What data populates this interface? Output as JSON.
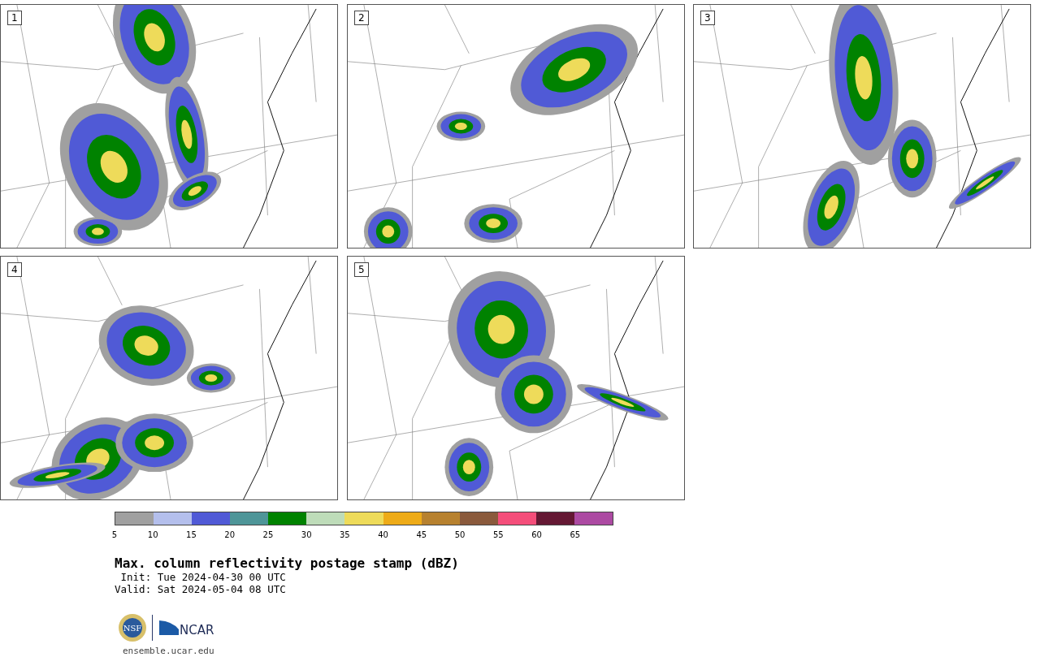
{
  "panels": [
    {
      "label": "1"
    },
    {
      "label": "2"
    },
    {
      "label": "3"
    },
    {
      "label": "4"
    },
    {
      "label": "5"
    }
  ],
  "colorbar": {
    "segments": [
      {
        "color": "#a0a0a0"
      },
      {
        "color": "#b4bfec"
      },
      {
        "color": "#505ad6"
      },
      {
        "color": "#4e9598"
      },
      {
        "color": "#008200"
      },
      {
        "color": "#bedcb9"
      },
      {
        "color": "#eedb5a"
      },
      {
        "color": "#eeab18"
      },
      {
        "color": "#b7812f"
      },
      {
        "color": "#8a5a3c"
      },
      {
        "color": "#f44e7a"
      },
      {
        "color": "#641833"
      },
      {
        "color": "#ac4aa2"
      }
    ],
    "ticks": [
      "5",
      "10",
      "15",
      "20",
      "25",
      "30",
      "35",
      "40",
      "45",
      "50",
      "55",
      "60",
      "65"
    ]
  },
  "title": "Max. column reflectivity postage stamp (dBZ)",
  "init": " Init: Tue 2024-04-30 00 UTC",
  "valid": "Valid: Sat 2024-05-04 08 UTC",
  "logo": {
    "nsf": "NSF",
    "ncar": "NCAR"
  },
  "footer": "ensemble.ucar.edu"
}
